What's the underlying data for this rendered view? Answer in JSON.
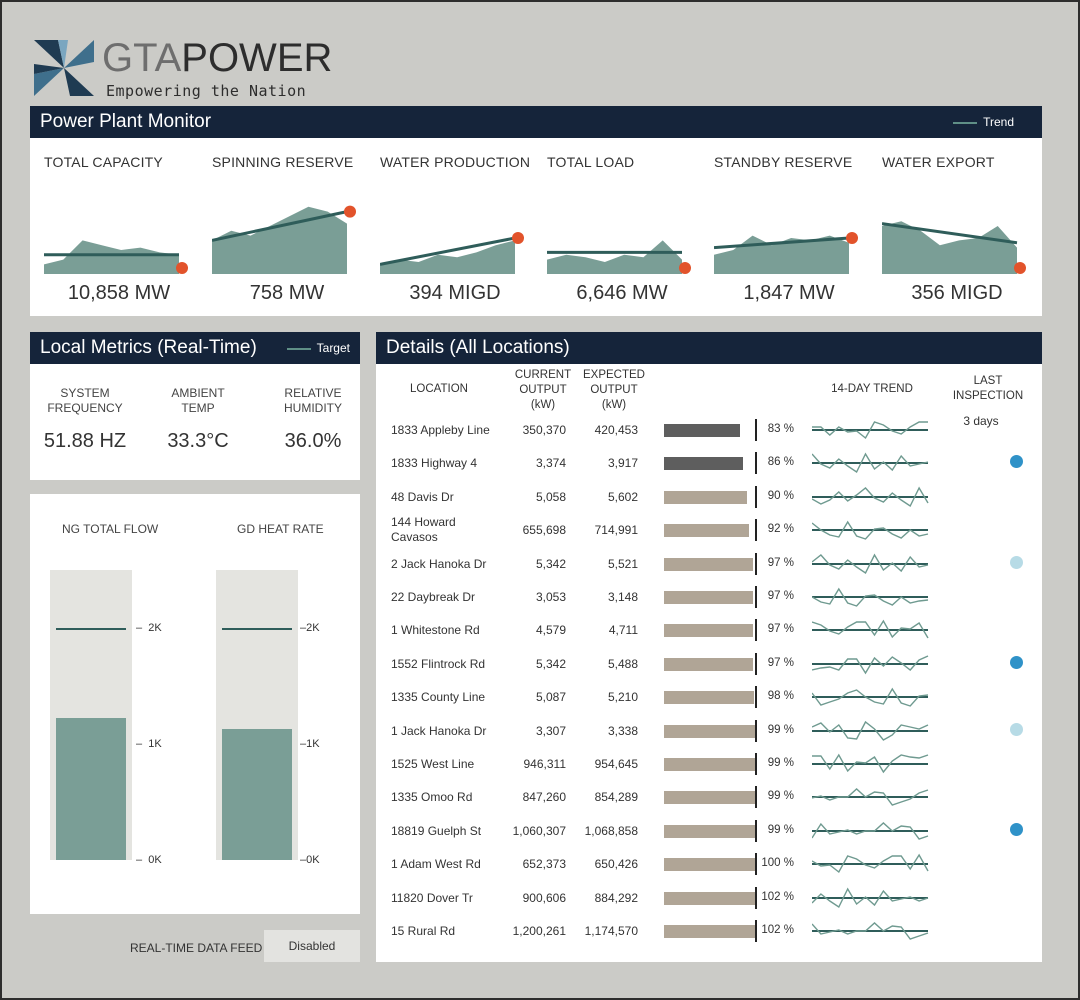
{
  "brand": {
    "name_a": "GTA",
    "name_b": "POWER",
    "tagline": "Empowering the Nation"
  },
  "colors": {
    "title_bar": "#15243a",
    "area_fill": "#7a9e96",
    "trend_line": "#2f5d5a",
    "end_dot": "#e2532b",
    "bar_dark": "#5e5e5e",
    "bar_light": "#b0a596",
    "dot_blue": "#2f92c8",
    "dot_light": "#b7dbe6"
  },
  "monitor": {
    "title": "Power Plant Monitor",
    "legend": "Trend",
    "kpis": [
      {
        "label": "TOTAL CAPACITY",
        "value": "10,858 MW",
        "series": [
          4,
          6,
          14,
          12,
          10,
          11,
          9,
          8
        ],
        "trend": [
          8,
          8
        ],
        "end": "low"
      },
      {
        "label": "SPINNING RESERVE",
        "value": "758 MW",
        "series": [
          14,
          18,
          16,
          20,
          24,
          28,
          26,
          21
        ],
        "trend": [
          14,
          26
        ],
        "end": "high"
      },
      {
        "label": "WATER PRODUCTION",
        "value": "394 MIGD",
        "series": [
          4,
          6,
          5,
          8,
          7,
          9,
          12,
          14
        ],
        "trend": [
          4,
          15
        ],
        "end": "high"
      },
      {
        "label": "TOTAL LOAD",
        "value": "6,646 MW",
        "series": [
          6,
          8,
          7,
          5,
          8,
          7,
          14,
          6
        ],
        "trend": [
          9,
          9
        ],
        "end": "low"
      },
      {
        "label": "STANDBY RESERVE",
        "value": "1,847 MW",
        "series": [
          8,
          10,
          16,
          12,
          15,
          14,
          16,
          13
        ],
        "trend": [
          11,
          15
        ],
        "end": "high"
      },
      {
        "label": "WATER EXPORT",
        "value": "356 MIGD",
        "series": [
          20,
          22,
          18,
          12,
          14,
          15,
          20,
          11
        ],
        "trend": [
          21,
          13
        ],
        "end": "low"
      }
    ]
  },
  "local": {
    "title": "Local Metrics (Real-Time)",
    "legend": "Target",
    "metrics": [
      {
        "label_1": "SYSTEM",
        "label_2": "FREQUENCY",
        "value": "51.88 HZ"
      },
      {
        "label_1": "AMBIENT",
        "label_2": "TEMP",
        "value": "33.3°C"
      },
      {
        "label_1": "RELATIVE",
        "label_2": "HUMIDITY",
        "value": "36.0%"
      }
    ]
  },
  "flow": {
    "bars": [
      {
        "label": "NG TOTAL FLOW",
        "level": 1220,
        "target": 2000
      },
      {
        "label": "GD HEAT RATE",
        "level": 1130,
        "target": 2000
      }
    ],
    "ticks_left": [
      "2K",
      "1K",
      "0K"
    ],
    "ticks_right": [
      "2K",
      "1K",
      "0K"
    ],
    "max": 2500
  },
  "feed": {
    "label": "REAL-TIME DATA FEED",
    "button": "Disabled"
  },
  "details": {
    "title": "Details (All Locations)",
    "headers": {
      "location": "LOCATION",
      "current": [
        "CURRENT",
        "OUTPUT",
        "(kW)"
      ],
      "expected": [
        "EXPECTED",
        "OUTPUT",
        "(kW)"
      ],
      "trend": "14-DAY TREND",
      "inspection": [
        "LAST",
        "INSPECTION"
      ]
    },
    "rows": [
      {
        "location": "1833 Appleby Line",
        "current": "350,370",
        "expected": "420,453",
        "pct": "83 %",
        "ratio": 0.83,
        "bar": "dark",
        "inspection": "3 days",
        "dot": ""
      },
      {
        "location": "1833 Highway 4",
        "current": "3,374",
        "expected": "3,917",
        "pct": "86 %",
        "ratio": 0.86,
        "bar": "dark",
        "inspection": "",
        "dot": "blue"
      },
      {
        "location": "48 Davis Dr",
        "current": "5,058",
        "expected": "5,602",
        "pct": "90 %",
        "ratio": 0.9,
        "bar": "light",
        "inspection": "",
        "dot": ""
      },
      {
        "location": "144 Howard",
        "location_2": "Cavasos",
        "current": "655,698",
        "expected": "714,991",
        "pct": "92 %",
        "ratio": 0.92,
        "bar": "light",
        "inspection": "",
        "dot": ""
      },
      {
        "location": "2 Jack Hanoka Dr",
        "current": "5,342",
        "expected": "5,521",
        "pct": "97 %",
        "ratio": 0.97,
        "bar": "light",
        "inspection": "",
        "dot": "light"
      },
      {
        "location": "22 Daybreak Dr",
        "current": "3,053",
        "expected": "3,148",
        "pct": "97 %",
        "ratio": 0.97,
        "bar": "light",
        "inspection": "",
        "dot": ""
      },
      {
        "location": "1 Whitestone Rd",
        "current": "4,579",
        "expected": "4,711",
        "pct": "97 %",
        "ratio": 0.97,
        "bar": "light",
        "inspection": "",
        "dot": ""
      },
      {
        "location": "1552 Flintrock Rd",
        "current": "5,342",
        "expected": "5,488",
        "pct": "97 %",
        "ratio": 0.97,
        "bar": "light",
        "inspection": "",
        "dot": "blue"
      },
      {
        "location": "1335 County Line",
        "current": "5,087",
        "expected": "5,210",
        "pct": "98 %",
        "ratio": 0.98,
        "bar": "light",
        "inspection": "",
        "dot": ""
      },
      {
        "location": "1 Jack Hanoka Dr",
        "current": "3,307",
        "expected": "3,338",
        "pct": "99 %",
        "ratio": 0.99,
        "bar": "light",
        "inspection": "",
        "dot": "light"
      },
      {
        "location": "1525 West Line",
        "current": "946,311",
        "expected": "954,645",
        "pct": "99 %",
        "ratio": 0.99,
        "bar": "light",
        "inspection": "",
        "dot": ""
      },
      {
        "location": "1335 Omoo Rd",
        "current": "847,260",
        "expected": "854,289",
        "pct": "99 %",
        "ratio": 0.99,
        "bar": "light",
        "inspection": "",
        "dot": ""
      },
      {
        "location": "18819 Guelph St",
        "current": "1,060,307",
        "expected": "1,068,858",
        "pct": "99 %",
        "ratio": 0.99,
        "bar": "light",
        "inspection": "",
        "dot": "blue"
      },
      {
        "location": "1 Adam West Rd",
        "current": "652,373",
        "expected": "650,426",
        "pct": "100 %",
        "ratio": 1.0,
        "bar": "light",
        "inspection": "",
        "dot": ""
      },
      {
        "location": "11820 Dover Tr",
        "current": "900,606",
        "expected": "884,292",
        "pct": "102 %",
        "ratio": 1.02,
        "bar": "light",
        "inspection": "",
        "dot": ""
      },
      {
        "location": "15 Rural Rd",
        "current": "1,200,261",
        "expected": "1,174,570",
        "pct": "102 %",
        "ratio": 1.02,
        "bar": "light",
        "inspection": "",
        "dot": ""
      }
    ]
  }
}
